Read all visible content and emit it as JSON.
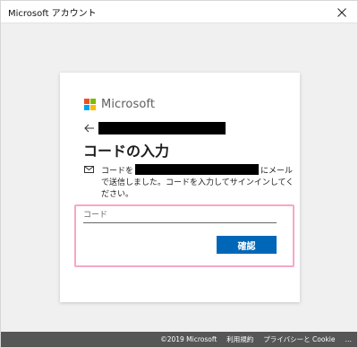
{
  "window": {
    "title": "Microsoft アカウント"
  },
  "brand": {
    "name": "Microsoft"
  },
  "page": {
    "heading": "コードの入力",
    "description_before": "コードを",
    "description_after": "にメールで送信しました。コードを入力してサインインしてください。"
  },
  "form": {
    "code_placeholder": "コード",
    "confirm_label": "確認"
  },
  "footer": {
    "copyright": "©2019 Microsoft",
    "terms": "利用規約",
    "privacy": "プライバシーと Cookie",
    "more": "…"
  },
  "colors": {
    "primary_button": "#0067b8",
    "highlight_border": "#f4a8c8",
    "ms_red": "#f25022",
    "ms_green": "#7fba00",
    "ms_blue": "#00a4ef",
    "ms_yellow": "#ffb900"
  },
  "icons": {
    "close": "close-icon",
    "back": "back-arrow-icon",
    "mail": "mail-icon"
  }
}
